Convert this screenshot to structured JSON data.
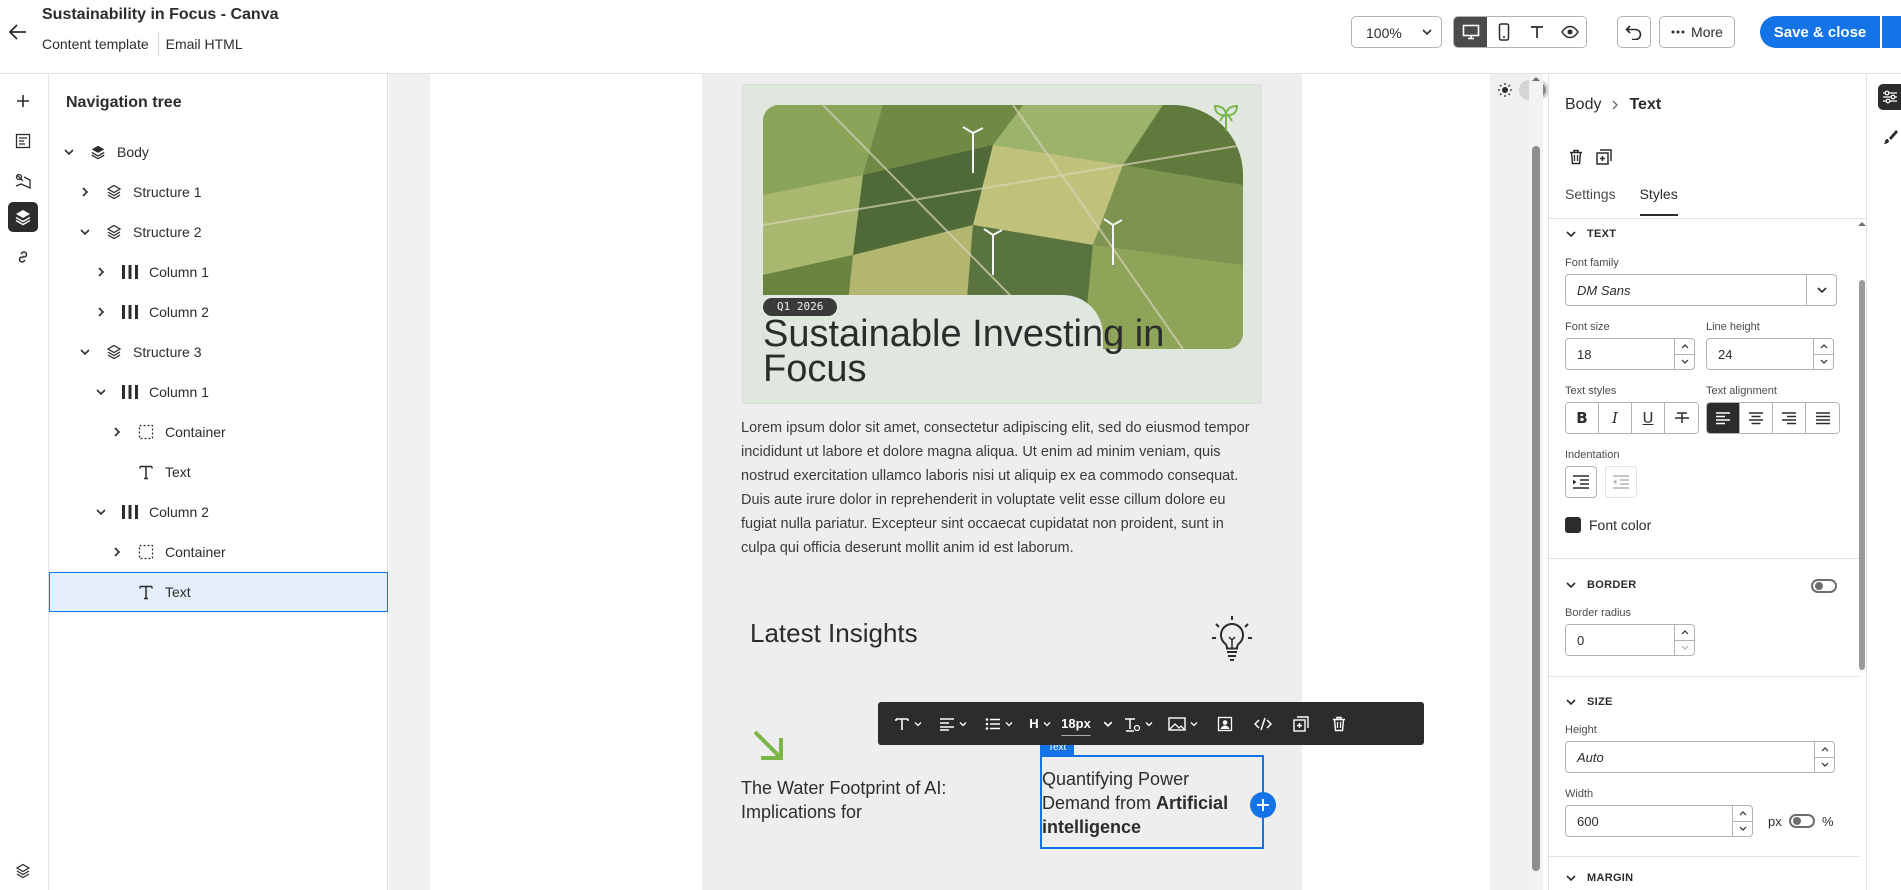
{
  "app": {
    "title": "Sustainability in Focus - Canva",
    "subtitle_type": "Content template",
    "subtitle_format": "Email HTML"
  },
  "toolbar": {
    "zoom": "100%",
    "more_label": "More",
    "save_label": "Save & close"
  },
  "nav": {
    "title": "Navigation tree",
    "items": [
      {
        "label": "Body",
        "expanded": true,
        "icon": "layers-icon"
      },
      {
        "label": "Structure 1",
        "expanded": false,
        "icon": "stack-icon"
      },
      {
        "label": "Structure 2",
        "expanded": true,
        "icon": "stack-icon"
      },
      {
        "label": "Column 1",
        "expanded": false,
        "icon": "columns-icon"
      },
      {
        "label": "Column 2",
        "expanded": false,
        "icon": "columns-icon"
      },
      {
        "label": "Structure 3",
        "expanded": true,
        "icon": "stack-icon"
      },
      {
        "label": "Column 1",
        "expanded": true,
        "icon": "columns-icon"
      },
      {
        "label": "Container",
        "expanded": false,
        "icon": "container-icon"
      },
      {
        "label": "Text",
        "icon": "text-icon"
      },
      {
        "label": "Column 2",
        "expanded": true,
        "icon": "columns-icon"
      },
      {
        "label": "Container",
        "expanded": false,
        "icon": "container-icon"
      },
      {
        "label": "Text",
        "icon": "text-icon",
        "selected": true
      }
    ]
  },
  "email": {
    "badge": "Q1 2026",
    "hero_title": "Sustainable Investing in Focus",
    "body": "Lorem ipsum dolor sit amet, consectetur adipiscing elit, sed do eiusmod tempor incididunt ut labore et dolore magna aliqua. Ut enim ad minim veniam, quis nostrud exercitation ullamco laboris nisi ut aliquip ex ea commodo consequat. Duis aute irure dolor in reprehenderit in voluptate velit esse cillum dolore eu fugiat nulla pariatur. Excepteur sint occaecat cupidatat non proident, sunt in culpa qui officia deserunt mollit anim id est laborum.",
    "insights_title": "Latest Insights",
    "col1_text": "The Water Footprint of AI: Implications for",
    "col2_text_plain": "Quantifying Power Demand from ",
    "col2_text_bold": "Artificial intelligence",
    "selected_tag": "Text"
  },
  "rte": {
    "heading": "H",
    "font_size": "18px"
  },
  "props": {
    "crumb_parent": "Body",
    "crumb_current": "Text",
    "tab_settings": "Settings",
    "tab_styles": "Styles",
    "text_section": "TEXT",
    "font_family_label": "Font family",
    "font_family": "DM Sans",
    "font_size_label": "Font size",
    "font_size": "18",
    "line_height_label": "Line height",
    "line_height": "24",
    "text_styles_label": "Text styles",
    "text_alignment_label": "Text alignment",
    "indentation_label": "Indentation",
    "font_color_label": "Font color",
    "font_color": "#2c2c2c",
    "border_section": "BORDER",
    "border_radius_label": "Border radius",
    "border_radius": "0",
    "size_section": "SIZE",
    "height_label": "Height",
    "height": "Auto",
    "width_label": "Width",
    "width": "600",
    "unit_px": "px",
    "unit_pct": "%",
    "margin_section": "MARGIN"
  },
  "colors": {
    "accent": "#1473e6",
    "dark": "#2c2c2c",
    "leaf_green": "#7ab648"
  }
}
